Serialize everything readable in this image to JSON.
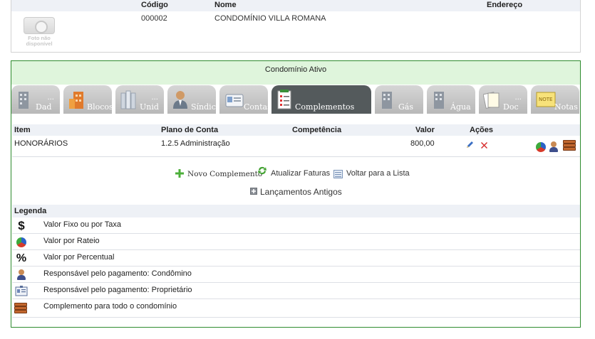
{
  "header": {
    "columns": [
      "Código",
      "Nome",
      "Endereço"
    ],
    "photo_text": "Foto não disponível",
    "codigo": "000002",
    "nome": "CONDOMÍNIO VILLA ROMANA",
    "endereco": ""
  },
  "panel": {
    "title": "Condomínio Ativo",
    "tabs": [
      {
        "label": "Dad",
        "icon": "building-icon",
        "dots": "..."
      },
      {
        "label": "Blocos",
        "icon": "blocks-icon",
        "dots": ""
      },
      {
        "label": "Unid",
        "icon": "units-icon",
        "dots": "..."
      },
      {
        "label": "Síndico",
        "icon": "manager-icon",
        "dots": ""
      },
      {
        "label": "Contas",
        "icon": "accounts-icon",
        "dots": ""
      },
      {
        "label": "Complementos",
        "icon": "checklist-icon",
        "dots": "",
        "active": true
      },
      {
        "label": "Gás",
        "icon": "gas-icon",
        "dots": ""
      },
      {
        "label": "Água",
        "icon": "water-icon",
        "dots": ""
      },
      {
        "label": "Doc",
        "icon": "documents-icon",
        "dots": "..."
      },
      {
        "label": "Notas",
        "icon": "note-icon",
        "dots": ""
      }
    ]
  },
  "table": {
    "headers": {
      "item": "Item",
      "plano": "Plano de Conta",
      "competencia": "Competência",
      "valor": "Valor",
      "acoes": "Ações"
    },
    "rows": [
      {
        "item": "HONORÁRIOS",
        "plano": "1.2.5 Administração",
        "competencia": "",
        "valor": "800,00"
      }
    ]
  },
  "actions": {
    "novo": "Novo Complemento",
    "atualizar": "Atualizar Faturas",
    "voltar": "Voltar para a Lista",
    "antigos": "Lançamentos Antigos"
  },
  "legend": {
    "title": "Legenda",
    "items": [
      {
        "icon": "dollar-icon",
        "text": "Valor Fixo ou por Taxa"
      },
      {
        "icon": "pie-chart-icon",
        "text": "Valor por Rateio"
      },
      {
        "icon": "percent-icon",
        "text": "Valor por Percentual"
      },
      {
        "icon": "person-icon",
        "text": "Responsável pelo pagamento: Condômino"
      },
      {
        "icon": "id-card-icon",
        "text": "Responsável pelo pagamento: Proprietário"
      },
      {
        "icon": "stack-icon",
        "text": "Complemento para todo o condomínio"
      }
    ]
  },
  "colors": {
    "panel_border": "#2e8b2e",
    "panel_title_bg": "#dff5dc",
    "active_tab": "#545a5c",
    "header_bg": "#eef1f6"
  }
}
